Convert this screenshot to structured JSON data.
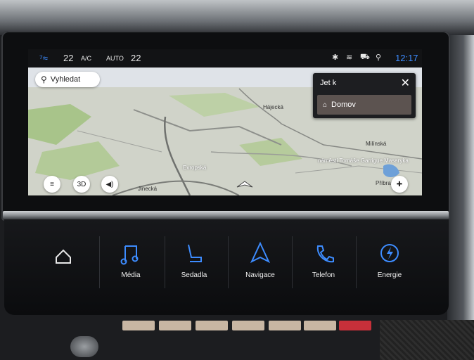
{
  "status_bar": {
    "fan_icon": "fan-icon",
    "temp_left": "22",
    "ac_label": "A/C",
    "auto_label": "AUTO",
    "temp_right": "22",
    "time": "12:17",
    "icons": [
      "bluetooth-icon",
      "wifi-icon",
      "car-connect-icon",
      "location-icon"
    ]
  },
  "map": {
    "search_label": "Vyhledat",
    "labels": {
      "hajecka": "Hájecká",
      "evropska": "Evropská",
      "jinecka": "Jinecká",
      "milinska": "Milínská",
      "namesti": "náměstí Tomáše Garrigue Masaryka",
      "pribram": "Příbram"
    },
    "btn_3d": "3D"
  },
  "goto_panel": {
    "title": "Jet k",
    "item_home": "Domov"
  },
  "controls": {
    "items": [
      {
        "label": ""
      },
      {
        "label": "Média"
      },
      {
        "label": "Sedadla"
      },
      {
        "label": "Navigace"
      },
      {
        "label": "Telefon"
      },
      {
        "label": "Energie"
      }
    ]
  },
  "colors": {
    "accent_blue": "#3d8cff",
    "panel_bg": "#1d1e21",
    "home_item": "#5c5350"
  }
}
